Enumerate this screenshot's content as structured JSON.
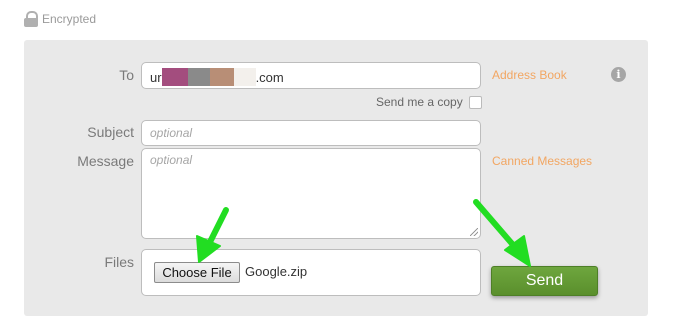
{
  "header": {
    "encrypted_label": "Encrypted"
  },
  "form": {
    "to_label": "To",
    "to_value_prefix": "ur",
    "to_value_suffix": ".com",
    "address_book_label": "Address Book",
    "send_copy_label": "Send me a copy",
    "subject_label": "Subject",
    "subject_placeholder": "optional",
    "message_label": "Message",
    "message_placeholder": "optional",
    "canned_messages_label": "Canned Messages",
    "files_label": "Files",
    "choose_file_label": "Choose File",
    "file_name": "Google.zip",
    "send_label": "Send",
    "info_icon_glyph": "i"
  },
  "colors": {
    "panel_bg": "#e9e9e9",
    "link_orange": "#f2a662",
    "send_green": "#5a8f2c",
    "arrow_green": "#22dd22"
  }
}
